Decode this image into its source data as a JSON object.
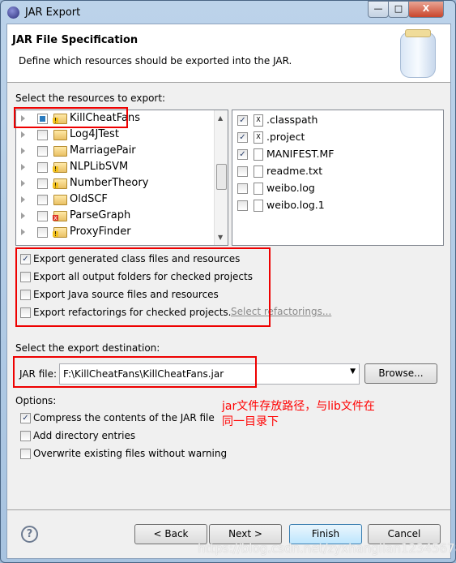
{
  "window": {
    "title": "JAR Export",
    "minimize": "—",
    "maximize": "□",
    "close": "X"
  },
  "header": {
    "title": "JAR File Specification",
    "description": "Define which resources should be exported into the JAR."
  },
  "resources": {
    "label": "Select the resources to export:",
    "projects": [
      {
        "name": "KillCheatFans",
        "state": "partial",
        "badge": "warning"
      },
      {
        "name": "Log4JTest",
        "state": "unchecked",
        "badge": "none"
      },
      {
        "name": "MarriagePair",
        "state": "unchecked",
        "badge": "none"
      },
      {
        "name": "NLPLibSVM",
        "state": "unchecked",
        "badge": "warning"
      },
      {
        "name": "NumberTheory",
        "state": "unchecked",
        "badge": "warning"
      },
      {
        "name": "OldSCF",
        "state": "unchecked",
        "badge": "none"
      },
      {
        "name": "ParseGraph",
        "state": "unchecked",
        "badge": "error"
      },
      {
        "name": "ProxyFinder",
        "state": "unchecked",
        "badge": "warning"
      }
    ],
    "files": [
      {
        "name": ".classpath",
        "checked": true
      },
      {
        "name": ".project",
        "checked": true
      },
      {
        "name": "MANIFEST.MF",
        "checked": true
      },
      {
        "name": "readme.txt",
        "checked": false
      },
      {
        "name": "weibo.log",
        "checked": false
      },
      {
        "name": "weibo.log.1",
        "checked": false
      }
    ]
  },
  "export_options": [
    {
      "label": "Export generated class files and resources",
      "checked": true
    },
    {
      "label": "Export all output folders for checked projects",
      "checked": false
    },
    {
      "label": "Export Java source files and resources",
      "checked": false
    },
    {
      "label": "Export refactorings for checked projects.",
      "checked": false
    }
  ],
  "select_refactorings_link": "Select refactorings...",
  "destination": {
    "label": "Select the export destination:",
    "jar_label": "JAR file:",
    "jar_value": "F:\\KillCheatFans\\KillCheatFans.jar",
    "browse": "Browse..."
  },
  "options": {
    "label": "Options:",
    "items": [
      {
        "label": "Compress the contents of the JAR file",
        "checked": true
      },
      {
        "label": "Add directory entries",
        "checked": false
      },
      {
        "label": "Overwrite existing files without warning",
        "checked": false
      }
    ]
  },
  "annotation": {
    "line1": "jar文件存放路径，与lib文件在",
    "line2": "同一目录下",
    "color": "#ff0000"
  },
  "buttons": {
    "back": "< Back",
    "next": "Next >",
    "finish": "Finish",
    "cancel": "Cancel"
  },
  "watermark": "https://blog.csdn.net/zyxhangiian123456789"
}
